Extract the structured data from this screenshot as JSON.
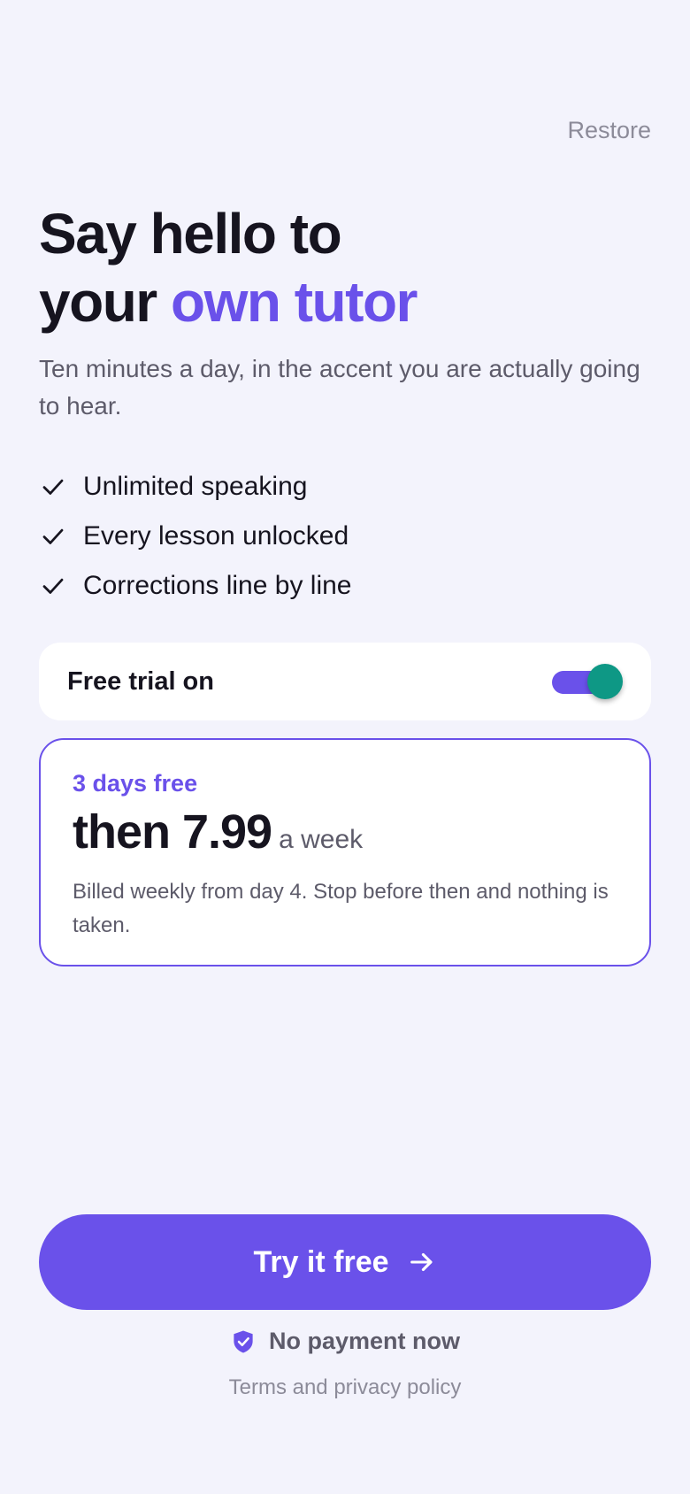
{
  "header": {
    "restore_label": "Restore"
  },
  "hero": {
    "title_line1": "Say hello to",
    "title_line2_plain": "your ",
    "title_line2_accent": "own tutor",
    "subtitle": "Ten minutes a day, in the accent you are actually going to hear."
  },
  "features": [
    {
      "icon": "check-icon",
      "label": "Unlimited speaking"
    },
    {
      "icon": "check-icon",
      "label": "Every lesson unlocked"
    },
    {
      "icon": "check-icon",
      "label": "Corrections line by line"
    }
  ],
  "trial_toggle": {
    "label": "Free trial on",
    "enabled": true
  },
  "plan": {
    "trial_text": "3 days free",
    "price_text": "then 7.99",
    "period_text": "a week",
    "note": "Billed weekly from day 4. Stop before then and nothing is taken."
  },
  "cta": {
    "label": "Try it free",
    "icon": "arrow-right-icon"
  },
  "footer": {
    "no_payment_icon": "shield-check-icon",
    "no_payment_label": "No payment now",
    "terms_label": "Terms and privacy policy"
  },
  "colors": {
    "background": "#f3f3fc",
    "accent": "#6a51ea",
    "toggle_thumb": "#0e9885",
    "text_primary": "#16141f",
    "text_secondary": "#5d5b6a",
    "text_muted": "#8c8b99"
  }
}
